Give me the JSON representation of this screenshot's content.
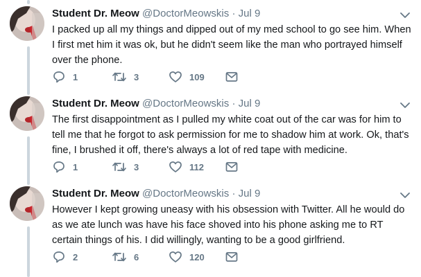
{
  "thread": {
    "tweets": [
      {
        "name": "Student Dr. Meow",
        "handle": "@DoctorMeowskis",
        "separator": "·",
        "time": "Jul 9",
        "text": "I packed up all my things and dipped out of my med school to go see him. When I first met him it was ok, but he didn't seem like the man who portrayed himself over the phone.",
        "replies": "1",
        "retweets": "3",
        "likes": "109"
      },
      {
        "name": "Student Dr. Meow",
        "handle": "@DoctorMeowskis",
        "separator": "·",
        "time": "Jul 9",
        "text": "The first disappointment as I pulled my white coat out of the car was for him to tell me that he forgot to ask permission for me to shadow him at work. Ok, that's fine, I brushed it off, there's always a lot of red tape with medicine.",
        "replies": "1",
        "retweets": "3",
        "likes": "112"
      },
      {
        "name": "Student Dr. Meow",
        "handle": "@DoctorMeowskis",
        "separator": "·",
        "time": "Jul 9",
        "text": "However I kept growing uneasy with his obsession with Twitter. All he would do as we ate lunch was have his face shoved into his phone asking me to RT certain things of his. I did willingly, wanting to be a good girlfriend.",
        "replies": "2",
        "retweets": "6",
        "likes": "120"
      }
    ]
  },
  "icons": {
    "reply": "reply-icon",
    "retweet": "retweet-icon",
    "like": "heart-icon",
    "dm": "envelope-icon",
    "caret": "chevron-down-icon"
  },
  "colors": {
    "text": "#14171a",
    "secondary": "#657786",
    "thread_line": "#ccd6dd"
  }
}
